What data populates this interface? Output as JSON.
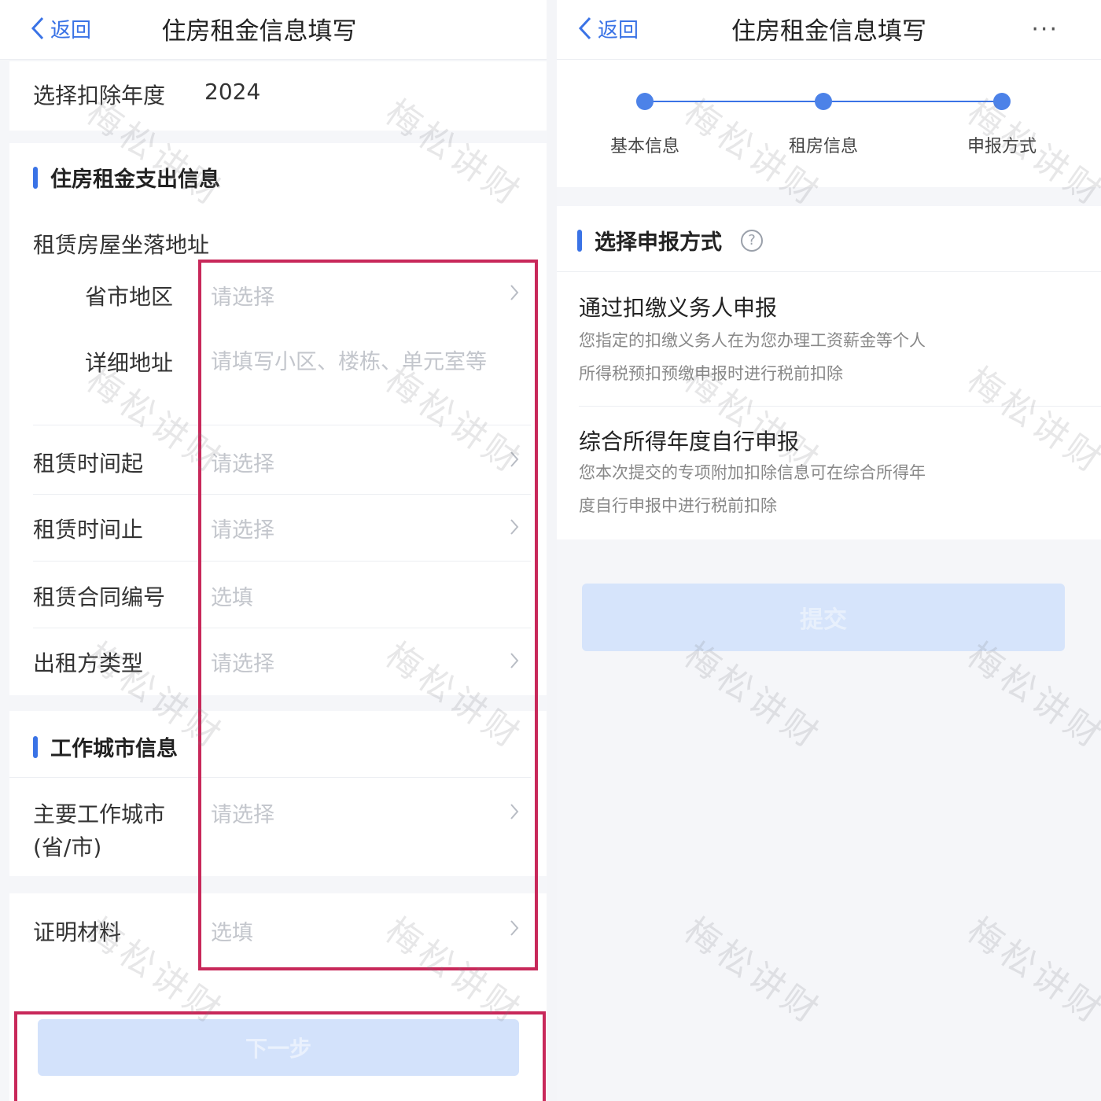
{
  "left": {
    "header": {
      "back_label": "返回",
      "title": "住房租金信息填写"
    },
    "year": {
      "label": "选择扣除年度",
      "value": "2024"
    },
    "rent_section": {
      "title": "住房租金支出信息"
    },
    "address_label": "租赁房屋坐落地址",
    "rows": [
      {
        "label": "省市地区",
        "value": "请选择"
      },
      {
        "label": "详细地址",
        "value": "请填写小区、楼栋、单元室等"
      },
      {
        "label": "租赁时间起",
        "value": "请选择"
      },
      {
        "label": "租赁时间止",
        "value": "请选择"
      },
      {
        "label": "租赁合同编号",
        "value": "选填"
      },
      {
        "label": "出租方类型",
        "value": "请选择"
      }
    ],
    "work_section": {
      "title": "工作城市信息"
    },
    "work_city": {
      "label_line1": "主要工作城市",
      "label_line2": "(省/市)",
      "value": "请选择"
    },
    "proof": {
      "label": "证明材料",
      "value": "选填"
    },
    "next_button": "下一步"
  },
  "right": {
    "header": {
      "back_label": "返回",
      "title": "住房租金信息填写",
      "more": "···"
    },
    "steps": [
      "基本信息",
      "租房信息",
      "申报方式"
    ],
    "section_title": "选择申报方式",
    "help_icon": "?",
    "options": [
      {
        "title": "通过扣缴义务人申报",
        "desc_line1": "您指定的扣缴义务人在为您办理工资薪金等个人",
        "desc_line2": "所得税预扣预缴申报时进行税前扣除"
      },
      {
        "title": "综合所得年度自行申报",
        "desc_line1": "您本次提交的专项附加扣除信息可在综合所得年",
        "desc_line2": "度自行申报中进行税前扣除"
      }
    ],
    "submit_button": "提交"
  },
  "watermark": "梅松讲财",
  "colors": {
    "accent": "#3a73e6",
    "highlight": "#c8285a",
    "placeholder": "#c3c6cc"
  }
}
